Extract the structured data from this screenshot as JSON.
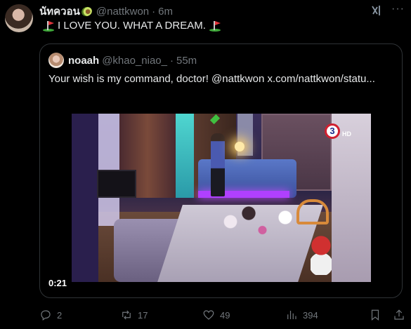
{
  "post": {
    "author_name": "นัทควอน",
    "author_handle": "@nattkwon",
    "separator": "·",
    "time": "6m",
    "text": "I LOVE YOU. WHAT A DREAM."
  },
  "quote": {
    "author_name": "noaah",
    "author_handle": "@khao_niao_",
    "separator": "·",
    "time": "55m",
    "text": "Your wish is my command, doctor! @nattkwon  x.com/nattkwon/statu...",
    "video": {
      "duration": "0:21",
      "channel_logo": "3",
      "channel_hd": "HD"
    }
  },
  "actions": {
    "replies": "2",
    "reposts": "17",
    "likes": "49",
    "views": "394"
  },
  "icons": {
    "grok": "grok-icon",
    "more": "more-icon",
    "reply": "reply-icon",
    "repost": "repost-icon",
    "like": "like-icon",
    "views": "views-icon",
    "bookmark": "bookmark-icon",
    "share": "share-icon"
  },
  "colors": {
    "background": "#000000",
    "text": "#e7e9ea",
    "muted": "#71767b",
    "border": "#2f3336"
  }
}
